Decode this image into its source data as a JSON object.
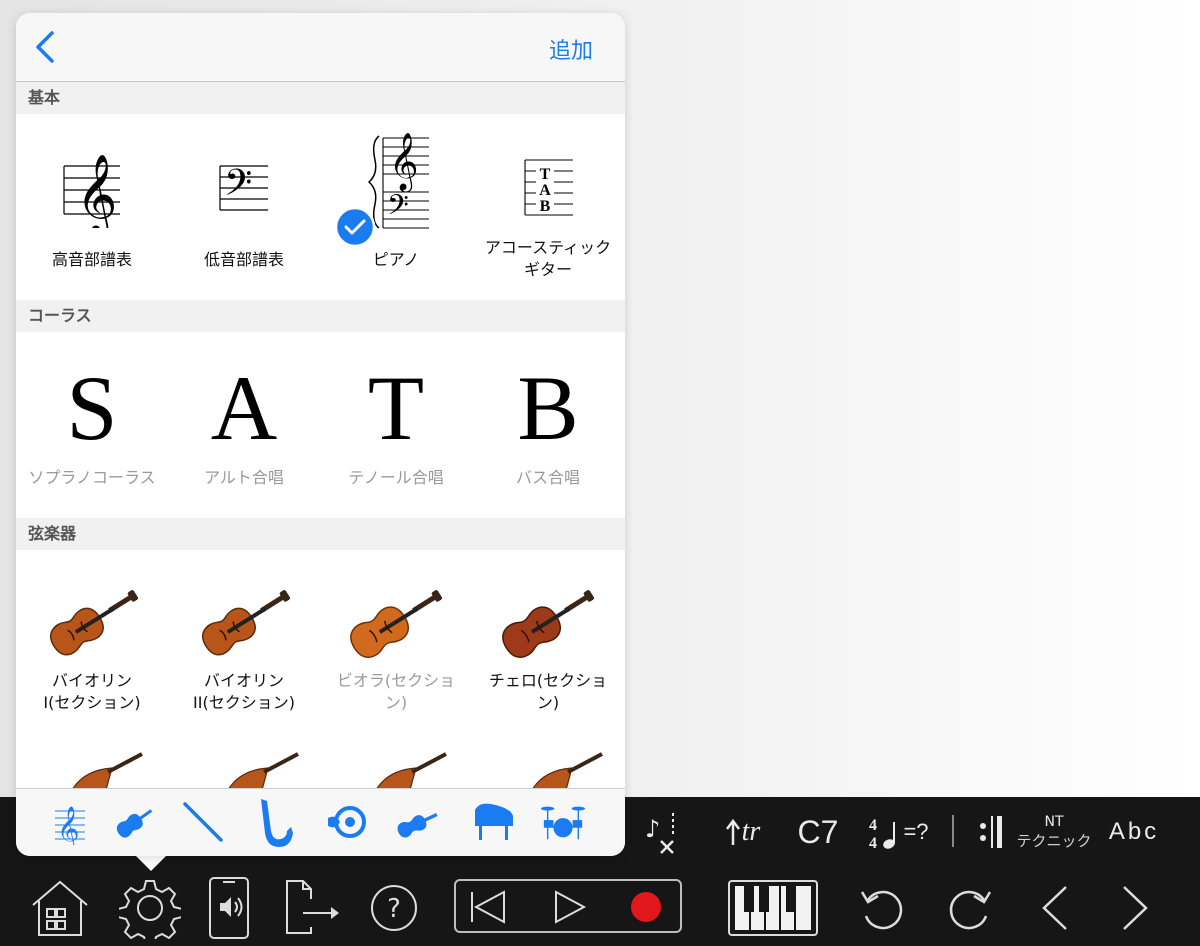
{
  "popup": {
    "add_label": "追加",
    "sections": [
      {
        "header": "基本",
        "items": [
          {
            "label": "高音部譜表",
            "icon": "treble-clef-staff-icon",
            "selected": false
          },
          {
            "label": "低音部譜表",
            "icon": "bass-clef-staff-icon",
            "selected": false
          },
          {
            "label": "ピアノ",
            "icon": "piano-grand-staff-icon",
            "selected": true
          },
          {
            "label": "アコースティック\nギター",
            "icon": "tab-staff-icon",
            "selected": false
          }
        ]
      },
      {
        "header": "コーラス",
        "items": [
          {
            "label": "ソプラノコーラス",
            "symbol": "S"
          },
          {
            "label": "アルト合唱",
            "symbol": "A"
          },
          {
            "label": "テノール合唱",
            "symbol": "T"
          },
          {
            "label": "バス合唱",
            "symbol": "B"
          }
        ]
      },
      {
        "header": "弦楽器",
        "items": [
          {
            "label": "バイオリン\nI(セクション)",
            "icon": "violin-icon"
          },
          {
            "label": "バイオリン\nII(セクション)",
            "icon": "violin-icon"
          },
          {
            "label": "ビオラ(セクショ\nン)",
            "icon": "viola-icon"
          },
          {
            "label": "チェロ(セクショ\nン)",
            "icon": "cello-icon"
          }
        ]
      }
    ],
    "tabs": [
      "treble-clef-icon",
      "violin-icon",
      "flute-icon",
      "saxophone-icon",
      "french-horn-icon",
      "guitar-icon",
      "piano-icon",
      "drums-icon"
    ],
    "accent_color": "#1a7cf0"
  },
  "toolbar": {
    "chord_label": "C7",
    "technique_top": "NT",
    "technique_bottom": "テクニック",
    "lyrics_label": "Abc",
    "trill_label": "tr",
    "tempo_suffix": "=?",
    "record_color": "#e0171b"
  }
}
